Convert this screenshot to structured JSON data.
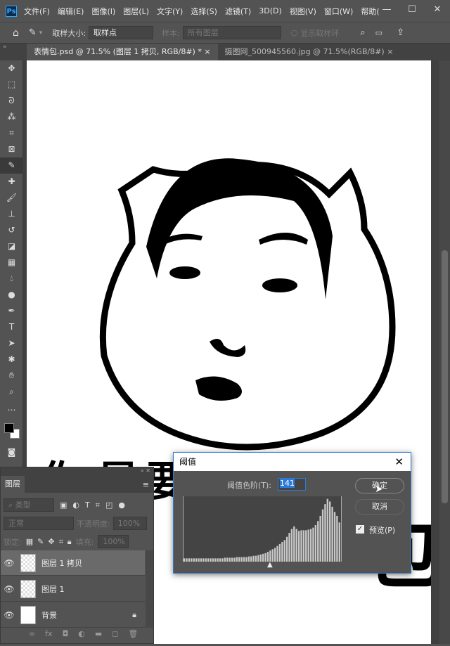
{
  "menu": {
    "items": [
      "文件(F)",
      "编辑(E)",
      "图像(I)",
      "图层(L)",
      "文字(Y)",
      "选择(S)",
      "滤镜(T)",
      "3D(D)",
      "视图(V)",
      "窗口(W)",
      "帮助("
    ],
    "controls": [
      "—",
      "☐",
      "✕"
    ]
  },
  "options": {
    "sample_size_label": "取样大小:",
    "sample_size_value": "取样点",
    "sample_label": "样本:",
    "sample_value": "所有图层",
    "show_ring": "显示取样环"
  },
  "tabs": [
    {
      "label": "表情包.psd @ 71.5% (图层 1 拷贝, RGB/8#) *",
      "close": "×"
    },
    {
      "label": "摄图网_500945560.jpg @ 71.5%(RGB/8#)",
      "close": "×"
    }
  ],
  "canvas": {
    "caption_chars": [
      "你",
      "是",
      "要",
      "包"
    ]
  },
  "layers": {
    "title": "图层",
    "filter_placeholder": "类型",
    "blend_mode": "正常",
    "opacity_label": "不透明度:",
    "opacity": "100%",
    "lock_label": "锁定:",
    "fill_label": "填充:",
    "fill": "100%",
    "items": [
      {
        "name": "图层 1 拷贝",
        "visible": true,
        "selected": true
      },
      {
        "name": "图层 1",
        "visible": true,
        "selected": false
      },
      {
        "name": "背景",
        "visible": true,
        "locked": true,
        "selected": false
      }
    ]
  },
  "dialog": {
    "title": "阈值",
    "level_label": "阈值色阶(T):",
    "level_value": "141",
    "ok": "确定",
    "cancel": "取消",
    "preview_label": "预览(P)",
    "preview_checked": true,
    "histogram": [
      5,
      5,
      5,
      5,
      5,
      5,
      5,
      5,
      5,
      5,
      5,
      5,
      5,
      5,
      5,
      5,
      5,
      6,
      6,
      6,
      6,
      6,
      7,
      7,
      7,
      7,
      7,
      8,
      8,
      9,
      9,
      10,
      11,
      12,
      13,
      15,
      17,
      19,
      21,
      24,
      27,
      30,
      33,
      38,
      44,
      50,
      54,
      50,
      47,
      48,
      48,
      48,
      49,
      50,
      52,
      56,
      62,
      70,
      80,
      88,
      96,
      92,
      84,
      76,
      70,
      60
    ],
    "threshold_max": 255
  }
}
